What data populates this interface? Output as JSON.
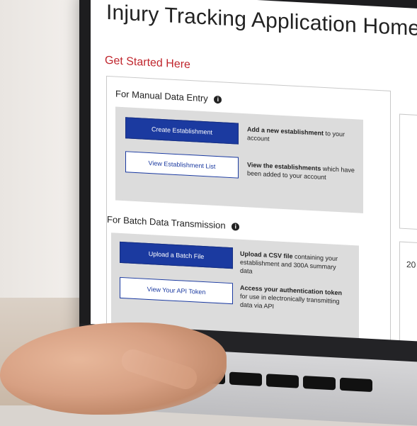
{
  "app": {
    "title": "Injury Tracking Application Home",
    "get_started": "Get Started Here"
  },
  "manual": {
    "heading": "For Manual Data Entry",
    "info_icon": "info-icon",
    "create_button": "Create Establishment",
    "create_desc_bold": "Add a new establishment",
    "create_desc_rest": " to your account",
    "view_button": "View Establishment List",
    "view_desc_bold": "View the establishments",
    "view_desc_rest": " which have been added to your account"
  },
  "batch": {
    "heading": "For Batch Data Transmission",
    "info_icon": "info-icon",
    "upload_button": "Upload a Batch File",
    "upload_desc_bold": "Upload a CSV file",
    "upload_desc_rest": " containing your establishment and 300A summary data",
    "api_button": "View Your API Token",
    "api_desc_bold": "Access your authentication token",
    "api_desc_rest": " for use in electronically transmitting data via API"
  },
  "side": {
    "partial_text": "20"
  },
  "colors": {
    "primary": "#1b3aa0",
    "accent_red": "#c0262d",
    "panel_gray": "#dcdcdc"
  }
}
